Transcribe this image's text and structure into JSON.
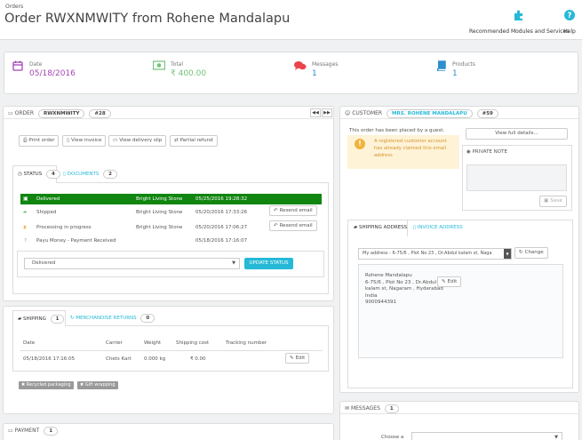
{
  "header": {
    "breadcrumb": "Orders",
    "title": "Order RWXNMWITY from Rohene Mandalapu",
    "toolbar": {
      "modules_label": "Recommended Modules and Services",
      "modules_icon": "puzzle-icon",
      "help_label": "Help",
      "help_icon": "question-icon"
    }
  },
  "kpis": {
    "date": {
      "label": "Date",
      "value": "05/18/2016",
      "icon": "calendar-icon",
      "color": "#a545b8"
    },
    "total": {
      "label": "Total",
      "value": "₹ 400.00",
      "icon": "money-icon",
      "color": "#72c279"
    },
    "messages": {
      "label": "Messages",
      "value": "1",
      "icon": "comments-icon",
      "color": "#e9454b"
    },
    "products": {
      "label": "Products",
      "value": "1",
      "icon": "book-icon",
      "color": "#2e8ece"
    }
  },
  "order_panel": {
    "heading": "ORDER",
    "reference": "RWXNMWITY",
    "id": "#28",
    "prev_icon": "backward-icon",
    "next_icon": "forward-icon",
    "actions": [
      "Print order",
      "View invoice",
      "View delivery slip",
      "Partial refund"
    ],
    "tabs": {
      "status": {
        "label": "STATUS",
        "count": "4"
      },
      "documents": {
        "label": "DOCUMENTS",
        "count": "2"
      }
    },
    "status_history": [
      {
        "status": "Delivered",
        "employee": "Bright Living Stone",
        "date": "05/25/2016 19:28:32",
        "action": ""
      },
      {
        "status": "Shipped",
        "employee": "Bright Living Stone",
        "date": "05/20/2016 17:33:26",
        "action": "Resend email"
      },
      {
        "status": "Processing in progress",
        "employee": "Bright Living Stone",
        "date": "05/20/2016 17:06:27",
        "action": "Resend email"
      },
      {
        "status": "Payu Money - Payment Received",
        "employee": "",
        "date": "05/18/2016 17:16:07",
        "action": ""
      }
    ],
    "status_select_value": "Delivered",
    "update_button": "UPDATE STATUS",
    "highlight_color": "#108510"
  },
  "shipping_panel": {
    "tabs": {
      "shipping": {
        "label": "SHIPPING",
        "count": "1"
      },
      "returns": {
        "label": "MERCHANDISE RETURNS",
        "count": "0"
      }
    },
    "columns": [
      "Date",
      "Carrier",
      "Weight",
      "Shipping cost",
      "Tracking number"
    ],
    "rows": [
      {
        "date": "05/18/2016 17:16:05",
        "carrier": "Chets Kart",
        "weight": "0.000 kg",
        "cost": "₹ 0.00",
        "tracking": "",
        "action": "Edit"
      }
    ],
    "tags": [
      "Recycled packaging",
      "Gift wrapping"
    ]
  },
  "payment_panel": {
    "heading": "PAYMENT",
    "count": "1"
  },
  "customer_panel": {
    "heading": "CUSTOMER",
    "name": "MRS. ROHENE MANDALAPU",
    "id": "#59",
    "guest_text": "This order has been placed by a guest.",
    "warning_text": "A registered customer account has already claimed this email address",
    "view_details": "View full details...",
    "private_note": {
      "label": "PRIVATE NOTE",
      "save": "Save"
    },
    "address_tabs": {
      "shipping": "SHIPPING ADDRESS",
      "invoice": "INVOICE ADDRESS"
    },
    "address_select": "My address - 6-75/6 , Plot No 23 , Dr.Abdul kalam st, Naga",
    "change_button": "Change",
    "address_lines": [
      "Rohene Mandalapu",
      "6-75/6 , Plot No 23 , Dr.Abdul",
      "kalam st, Nagaram , Hyderabad",
      "India",
      "9000944391"
    ],
    "edit_button": "Edit"
  },
  "messages_panel": {
    "heading": "MESSAGES",
    "count": "1",
    "choose_label": "Choose a"
  }
}
